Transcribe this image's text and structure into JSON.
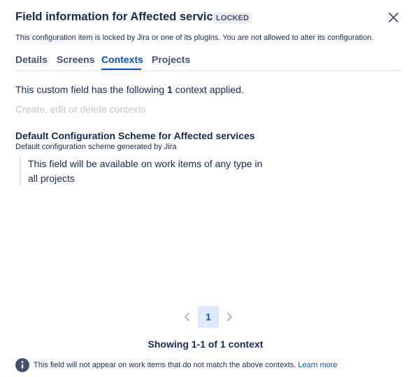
{
  "dialog": {
    "title": "Field information for Affected services",
    "status_lozenge": "LOCKED",
    "locked_message": "This configuration item is locked by Jira or one of its plugins. You are not allowed to alter its configuration."
  },
  "tabs": [
    {
      "label": "Details",
      "active": false
    },
    {
      "label": "Screens",
      "active": false
    },
    {
      "label": "Contexts",
      "active": true
    },
    {
      "label": "Projects",
      "active": false
    }
  ],
  "contexts": {
    "summary_prefix": "This custom field has the following",
    "count": "1",
    "summary_suffix": "context applied.",
    "edit_link": "Create, edit or delete contexts",
    "scheme": {
      "name": "Default Configuration Scheme for Affected services",
      "description": "Default configuration scheme generated by Jira",
      "applicability": "This field will be available on work items of any type in all projects"
    }
  },
  "pagination": {
    "current_page": "1",
    "showing_text": "Showing 1-1 of 1 context"
  },
  "footer": {
    "note": "This field will not appear on work items that do not match the above contexts.",
    "learn_more": "Learn more"
  },
  "colors": {
    "primary": "#0052cc",
    "text": "#172b4d",
    "disabled": "#c1c7d0",
    "selected_bg": "#deebff"
  },
  "icons": {
    "close": "close-icon",
    "prev": "chevron-left-icon",
    "next": "chevron-right-icon",
    "info": "info-icon"
  }
}
